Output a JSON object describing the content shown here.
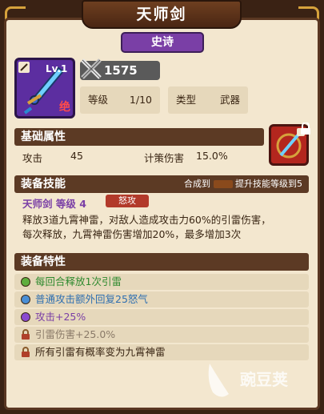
{
  "title": "天师剑",
  "rarity": "史诗",
  "item": {
    "level_label": "Lv.1",
    "corner_badge": "绝",
    "power": "1575"
  },
  "stats_top": {
    "level_label": "等级",
    "level_value": "1/10",
    "type_label": "类型",
    "type_value": "武器"
  },
  "base_attr": {
    "header": "基础属性",
    "attack_label": "攻击",
    "attack_value": "45",
    "strategy_label": "计策伤害",
    "strategy_value": "15.0%"
  },
  "skill": {
    "header": "装备技能",
    "synth_prefix": "合成到",
    "synth_suffix": "提升技能等级到5",
    "name_line": "天师剑 等级 4",
    "badge": "怒攻",
    "desc_line1": "释放3道九霄神雷，对敌人造成攻击力60%的引雷伤害，",
    "desc_line2": "每次释放，九霄神雷伤害增加20%，最多增加3次"
  },
  "traits": {
    "header": "装备特性",
    "items": [
      {
        "text": "每回合释放1次引雷",
        "color": "#2f8a2f",
        "dot": "#5fae3e",
        "locked": false
      },
      {
        "text": "普通攻击额外回复25怒气",
        "color": "#2f6fb0",
        "dot": "#4a8fd6",
        "locked": false
      },
      {
        "text": "攻击+25%",
        "color": "#7a3fa6",
        "dot": "#8a4ad0",
        "locked": false
      },
      {
        "text": "引雷伤害+25.0%",
        "color": "#8a7a68",
        "dot": "",
        "locked": true
      },
      {
        "text": "所有引雷有概率变为九霄神雷",
        "color": "#3a2614",
        "dot": "",
        "locked": true
      }
    ]
  },
  "watermark": "豌豆荚",
  "colors": {
    "accent": "#7a3fa6",
    "panel": "#f3e7cf",
    "frame": "#5a3722"
  }
}
